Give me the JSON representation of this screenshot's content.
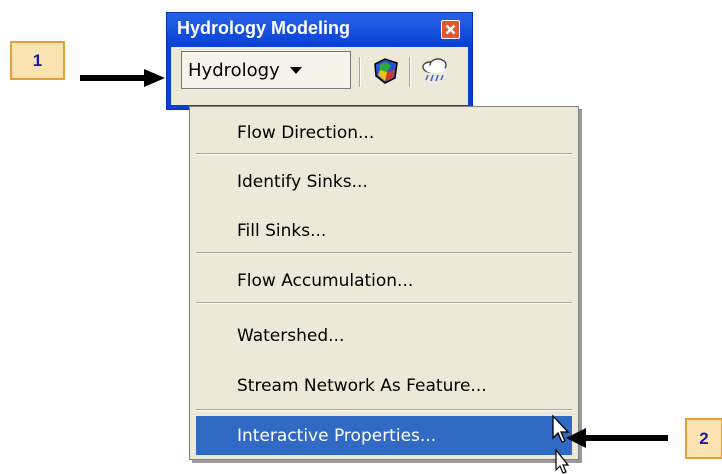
{
  "callouts": {
    "one": "1",
    "two": "2"
  },
  "toolbar": {
    "title": "Hydrology Modeling",
    "dropdown_label": "Hydrology",
    "tools": [
      "globe-icon",
      "rain-cloud-icon"
    ]
  },
  "menu": {
    "items": [
      {
        "label": "Flow Direction..."
      },
      {
        "label": "Identify Sinks..."
      },
      {
        "label": "Fill Sinks..."
      },
      {
        "label": "Flow Accumulation..."
      },
      {
        "label": "Watershed..."
      },
      {
        "label": "Stream Network As Feature..."
      },
      {
        "label": "Interactive Properties...",
        "highlighted": true
      }
    ]
  },
  "colors": {
    "title_bar": "#0b44d8",
    "menu_bg": "#ece9d8",
    "highlight": "#316ac5",
    "callout_bg": "#fbe3b1",
    "callout_border": "#e0a040",
    "callout_text": "#1a1aa8"
  }
}
